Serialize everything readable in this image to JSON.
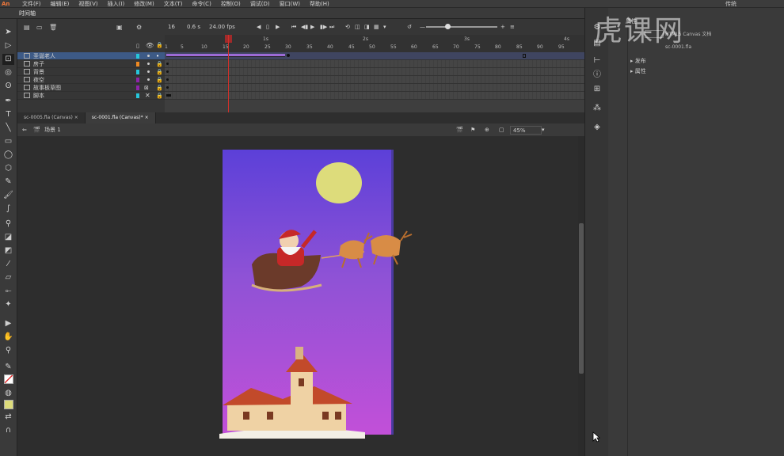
{
  "app": {
    "logo": "An",
    "workspace": "传统"
  },
  "menu": [
    "文件(F)",
    "编辑(E)",
    "视图(V)",
    "插入(I)",
    "修改(M)",
    "文本(T)",
    "命令(C)",
    "控制(O)",
    "调试(D)",
    "窗口(W)",
    "帮助(H)"
  ],
  "timeline": {
    "panel_title": "时间轴",
    "current_frame": "16",
    "time": "0.6 s",
    "fps": "24.00 fps",
    "seconds": [
      "1s",
      "2s",
      "3s",
      "4s"
    ],
    "frame_numbers": [
      "1",
      "5",
      "10",
      "15",
      "20",
      "25",
      "30",
      "35",
      "40",
      "45",
      "50",
      "55",
      "60",
      "65",
      "70",
      "75",
      "80",
      "85",
      "90",
      "95"
    ],
    "layers": [
      {
        "name": "圣诞老人",
        "color": "#26c6da",
        "selected": true
      },
      {
        "name": "房子",
        "color": "#ef8a22",
        "selected": false
      },
      {
        "name": "背景",
        "color": "#26c6da",
        "selected": false
      },
      {
        "name": "夜空",
        "color": "#8e24aa",
        "selected": false
      },
      {
        "name": "故事板草图",
        "color": "#8e24aa",
        "selected": false
      },
      {
        "name": "脚本",
        "color": "#26c6da",
        "selected": false
      }
    ]
  },
  "documents": {
    "tabs": [
      "sc-0005.fla (Canvas)",
      "sc-0001.fla (Canvas)*"
    ],
    "scene": "场景 1",
    "zoom": "45%"
  },
  "properties": {
    "tab": "属性",
    "doc_type": "HTML5 Canvas 文档",
    "filename": "sc-0001.fla",
    "sections": [
      "发布",
      "属性"
    ]
  },
  "watermark": "虎课网",
  "colors": {
    "stage_top": "#5c40d8",
    "stage_bottom": "#c250d8",
    "moon": "#dddc7b",
    "selected_layer": "#3d5a86",
    "playhead": "#d0302a"
  }
}
